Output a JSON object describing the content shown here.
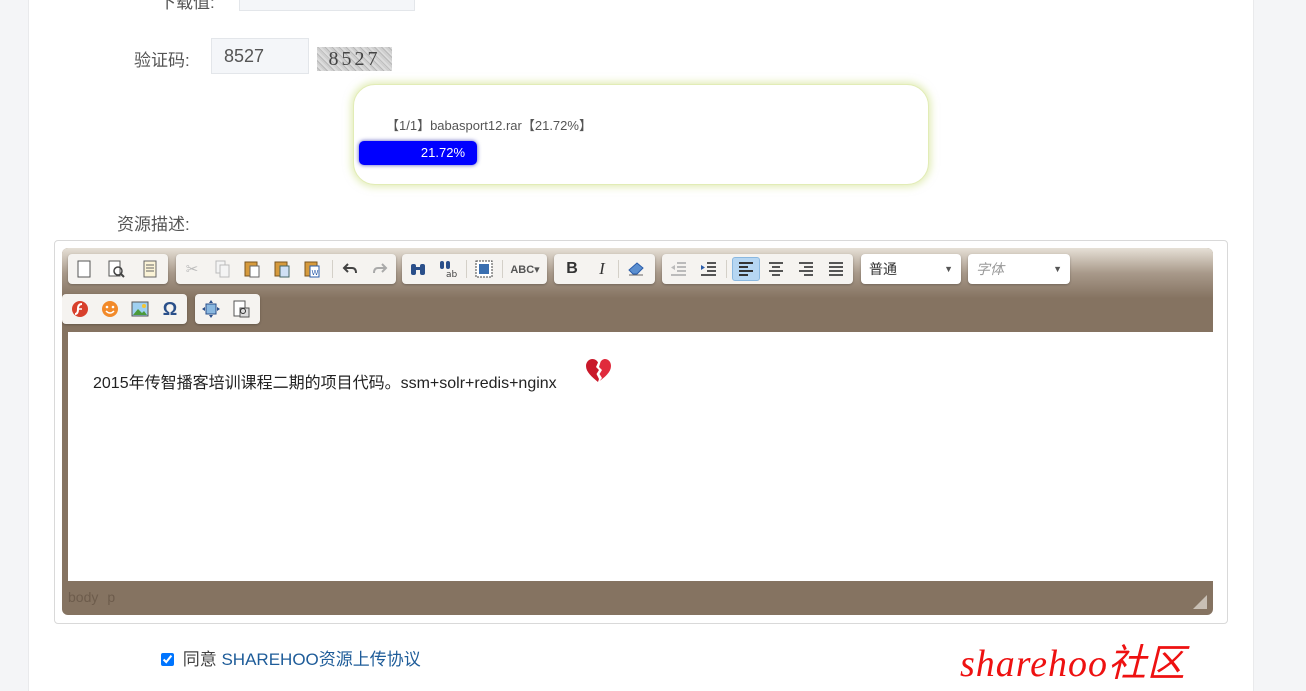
{
  "form": {
    "cut_label": "下载值:",
    "captcha": {
      "label": "验证码:",
      "value": "8527",
      "image_text": "8527"
    },
    "description_label": "资源描述:",
    "agree": {
      "checked": true,
      "prefix": "同意",
      "link": "SHAREHOO资源上传协议"
    }
  },
  "upload": {
    "file_text": "【1/1】babasport12.rar【21.72%】",
    "progress_text": "21.72%",
    "progress": 0.2172,
    "bar_color": "#0000ff"
  },
  "editor": {
    "toolbar_row1": [
      {
        "group": "document",
        "buttons": [
          "new-page-icon",
          "preview-icon",
          "templates-icon"
        ]
      },
      {
        "group": "clipboard",
        "buttons": [
          "cut-icon",
          "copy-icon",
          "paste-icon",
          "paste-text-icon",
          "paste-word-icon",
          "undo-icon",
          "redo-icon"
        ]
      },
      {
        "group": "editing",
        "buttons": [
          "find-icon",
          "replace-icon",
          "select-all-icon",
          "spellcheck-icon"
        ]
      },
      {
        "group": "basicstyles",
        "buttons": [
          "bold-icon",
          "italic-icon",
          "remove-format-icon"
        ]
      },
      {
        "group": "paragraph",
        "buttons": [
          "outdent-icon",
          "indent-icon",
          "align-left-icon",
          "align-center-icon",
          "align-right-icon",
          "justify-icon"
        ]
      }
    ],
    "format_combo": "普通",
    "font_combo": "字体",
    "toolbar_row2": [
      {
        "group": "insert",
        "buttons": [
          "flash-icon",
          "smiley-icon",
          "image-icon",
          "special-char-icon"
        ]
      },
      {
        "group": "tools",
        "buttons": [
          "maximize-icon",
          "show-blocks-icon"
        ]
      }
    ],
    "content": "2015年传智播客培训课程二期的项目代码。ssm+solr+redis+nginx",
    "content_emoji": "broken-heart-icon",
    "path": [
      "body",
      "p"
    ],
    "skin_color": "#857361"
  },
  "watermark": "sharehoo社区"
}
